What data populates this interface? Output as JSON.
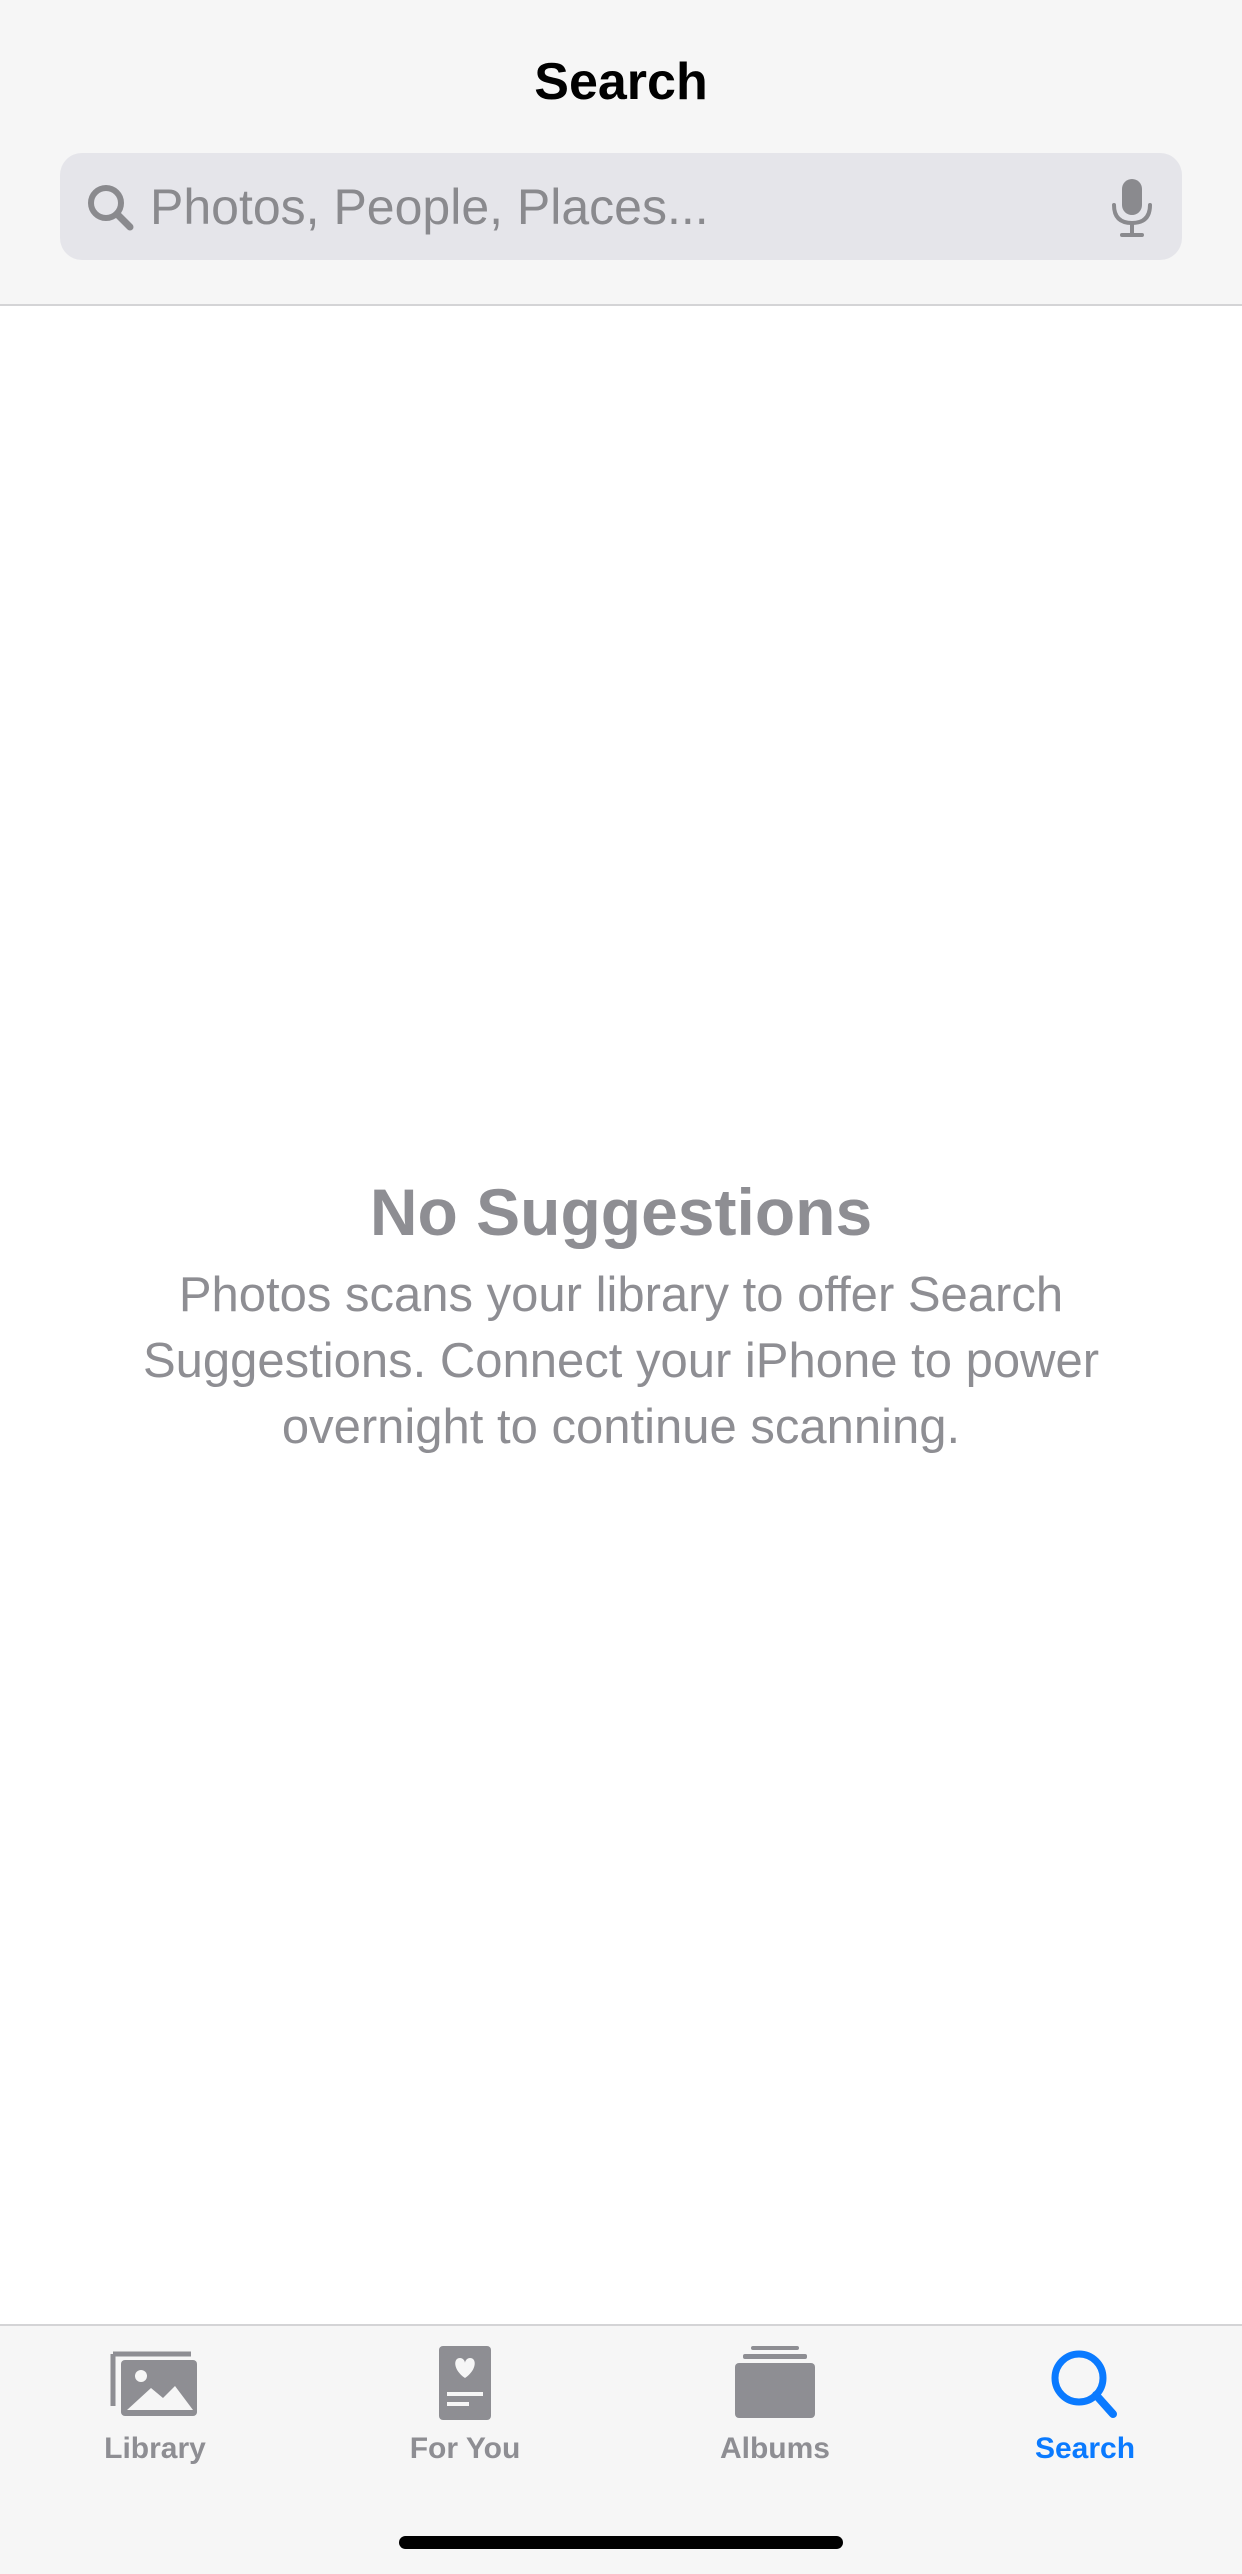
{
  "header": {
    "title": "Search"
  },
  "search": {
    "placeholder": "Photos, People, Places..."
  },
  "empty_state": {
    "title": "No Suggestions",
    "description": "Photos scans your library to offer Search Suggestions. Connect your iPhone to power overnight to continue scanning."
  },
  "tabs": [
    {
      "label": "Library",
      "icon": "photo-stack-icon",
      "active": false
    },
    {
      "label": "For You",
      "icon": "heart-card-icon",
      "active": false
    },
    {
      "label": "Albums",
      "icon": "albums-icon",
      "active": false
    },
    {
      "label": "Search",
      "icon": "search-icon",
      "active": true
    }
  ],
  "colors": {
    "accent": "#0a7aff",
    "inactive": "#8e8e93",
    "bar_background": "#f6f6f6",
    "search_field": "#e5e5ea"
  }
}
